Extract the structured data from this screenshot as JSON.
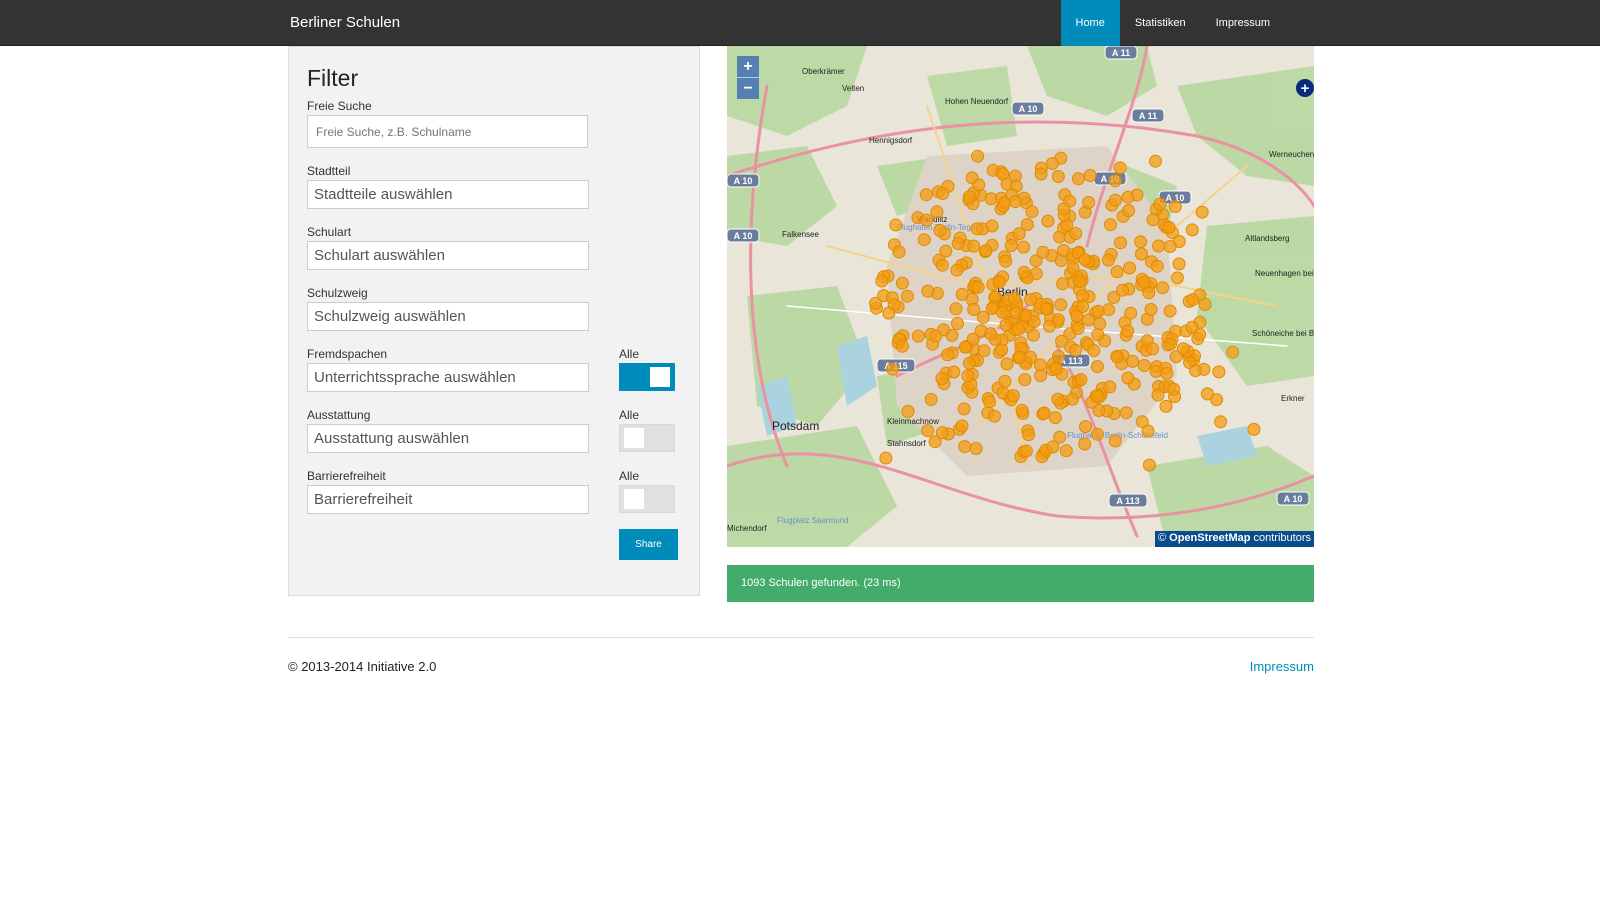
{
  "navbar": {
    "brand": "Berliner Schulen",
    "items": [
      {
        "label": "Home",
        "active": true
      },
      {
        "label": "Statistiken",
        "active": false
      },
      {
        "label": "Impressum",
        "active": false
      }
    ]
  },
  "filter": {
    "title": "Filter",
    "search": {
      "label": "Freie Suche",
      "placeholder": "Freie Suche, z.B. Schulname",
      "value": ""
    },
    "district": {
      "label": "Stadtteil",
      "value": "Stadtteile auswählen"
    },
    "school_type": {
      "label": "Schulart",
      "value": "Schulart auswählen"
    },
    "school_branch": {
      "label": "Schulzweig",
      "value": "Schulzweig auswählen"
    },
    "languages": {
      "label": "Fremdspachen",
      "value": "Unterrichtssprache auswählen",
      "toggle_label": "Alle",
      "toggle_on": true
    },
    "equipment": {
      "label": "Ausstattung",
      "value": "Ausstattung auswählen",
      "toggle_label": "Alle",
      "toggle_on": false
    },
    "accessibility": {
      "label": "Barrierefreiheit",
      "value": "Barrierefreiheit",
      "toggle_label": "Alle",
      "toggle_on": false
    },
    "share_label": "Share"
  },
  "map": {
    "zoom_in": "+",
    "zoom_out": "−",
    "attribution_prefix": "©",
    "attribution_link": "OpenStreetMap",
    "attribution_suffix": "contributors",
    "marker_color": "#f39c12",
    "places": [
      "Oberkrämer",
      "Velten",
      "Hohen Neuendorf",
      "Hennigsdorf",
      "Wandlitz",
      "Werneuchen",
      "Falkensee",
      "Altlandsberg",
      "Neuenhagen bei Berlin",
      "Schöneiche bei Berlin",
      "Erkner",
      "Potsdam",
      "Kleinmachnow",
      "Stahnsdorf",
      "Michendorf",
      "Berlin",
      "Flughafen Berlin-Tegel",
      "Flughafen Berlin-Schönefeld",
      "Flugplatz Saarmund"
    ],
    "road_labels": [
      "A 10",
      "A 11",
      "A 10",
      "A 10",
      "A 115",
      "A 113",
      "A 113",
      "A 10",
      "A 10",
      "A 10",
      "A 11"
    ]
  },
  "result": {
    "text": "1093 Schulen gefunden. (23 ms)"
  },
  "footer": {
    "copyright": "© 2013-2014 Initiative 2.0",
    "link": "Impressum"
  }
}
